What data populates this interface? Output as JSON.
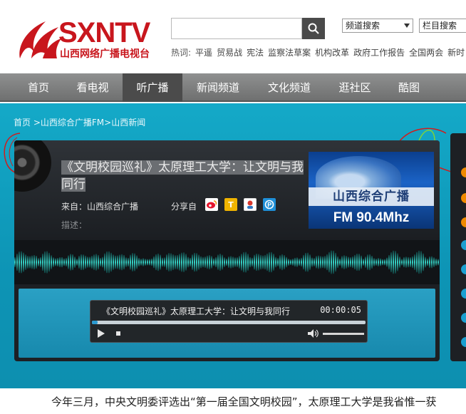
{
  "logo": {
    "wordmark": "SXNTV",
    "subtitle": "山西网络广播电视台",
    "brand_color": "#c8161d"
  },
  "search": {
    "placeholder": "",
    "button_icon": "search-icon",
    "channel_select": "频道搜索",
    "column_select": "栏目搜索"
  },
  "hot": {
    "label": "热词:",
    "terms": [
      "平遥",
      "贸易战",
      "宪法",
      "监察法草案",
      "机构改革",
      "政府工作报告",
      "全国两会",
      "新时"
    ]
  },
  "nav": {
    "items": [
      "首页",
      "看电视",
      "听广播",
      "新闻频道",
      "文化频道",
      "逛社区",
      "酷图"
    ],
    "active_index": 2,
    "bar_color": "#7a7b7b",
    "active_color": "#4b4b4b"
  },
  "breadcrumb": {
    "home": "首页",
    "sep1": " >",
    "level1": "山西综合广播FM",
    "sep2": ">",
    "level2": "山西新闻"
  },
  "program": {
    "title": "《文明校园巡礼》太原理工大学：让文明与我同行",
    "source": "来自：山西综合广播",
    "share_label": "分享自",
    "share_icons": [
      "weibo-icon",
      "tencent-icon",
      "renren-icon",
      "kaixin-icon"
    ],
    "description_label": "描述：",
    "station_name": "山西综合广播",
    "station_freq": "FM 90.4Mhz"
  },
  "player": {
    "track_title": "《文明校园巡礼》太原理工大学：让文明与我同行",
    "time": "00:00:05",
    "progress": 0.02,
    "play_icon": "play-icon",
    "stop_icon": "stop-icon",
    "volume_icon": "volume-icon"
  },
  "article": {
    "text": "今年三月，中央文明委评选出“第一届全国文明校园”，太原理工大学是我省惟一获"
  },
  "colors": {
    "main_bg": "#13a4c4",
    "player_bg": "#1d2024",
    "wave": "#37d5c8"
  }
}
